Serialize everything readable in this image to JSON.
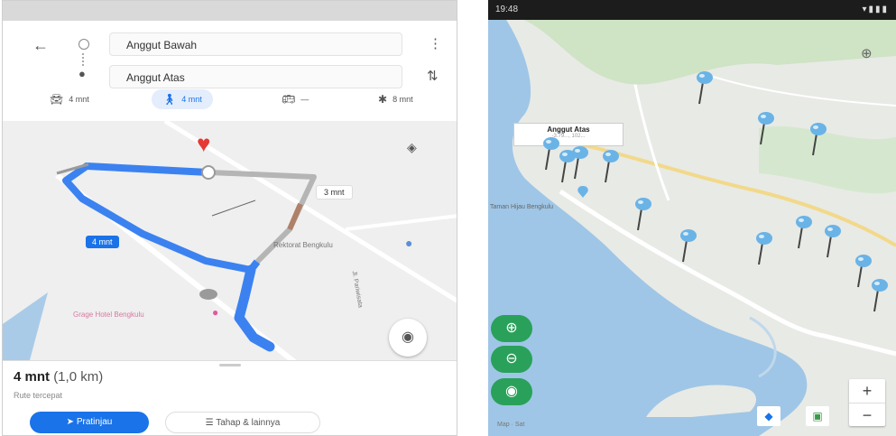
{
  "left": {
    "origin_field": "Anggut Bawah",
    "destination_field": "Anggut Atas",
    "modes": [
      {
        "name": "car",
        "label": "4 mnt"
      },
      {
        "name": "walk",
        "label": "4 mnt"
      },
      {
        "name": "transit",
        "label": "—"
      },
      {
        "name": "bike",
        "label": "8 mnt"
      }
    ],
    "route_chip": "4 mnt",
    "alt_chip": "3 mnt",
    "place_1": "Rektorat Bengkulu",
    "place_2": "Grage Hotel Bengkulu",
    "street_label": "Jl. Pariwisata",
    "summary_time": "4 mnt",
    "summary_dist": "(1,0 km)",
    "summary_note": "Rute tercepat",
    "btn_start": "Pratinjau",
    "btn_steps": "Tahap & lainnya",
    "colors": {
      "route": "#3b82f0",
      "alt": "#b9b9b9",
      "marker": "#e53935"
    }
  },
  "right": {
    "status_time": "19:48",
    "info_title": "Anggut Atas",
    "info_sub": "-3.79..., 102...",
    "place_label": "Taman Hijau Bengkulu",
    "zoom_in": "+",
    "zoom_out": "−",
    "attribution": "Map · Sat",
    "colors": {
      "water": "#9fc6e6",
      "land": "#e8eae6",
      "fab": "#2aa15a",
      "pin": "#6ab3e6"
    }
  }
}
